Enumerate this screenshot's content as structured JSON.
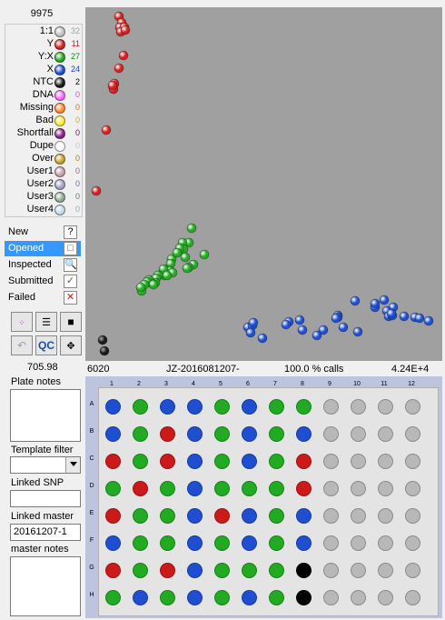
{
  "top_count": "9975",
  "legend": [
    {
      "label": "1:1",
      "count": "32",
      "color": "#c0c0c0",
      "count_color": "#a0a0a0"
    },
    {
      "label": "Y",
      "count": "11",
      "color": "#d42020",
      "count_color": "#c01818"
    },
    {
      "label": "Y:X",
      "count": "27",
      "color": "#22aa22",
      "count_color": "#118811"
    },
    {
      "label": "X",
      "count": "24",
      "color": "#1f4fd0",
      "count_color": "#1a3fcc"
    },
    {
      "label": "NTC",
      "count": "2",
      "color": "#1a1a1a",
      "count_color": "#000000"
    },
    {
      "label": "DNA",
      "count": "0",
      "color": "#ff66ff",
      "count_color": "#d050d0"
    },
    {
      "label": "Missing",
      "count": "0",
      "color": "#ff8833",
      "count_color": "#d07020"
    },
    {
      "label": "Bad",
      "count": "0",
      "color": "#ffee33",
      "count_color": "#c8b020"
    },
    {
      "label": "Shortfall",
      "count": "0",
      "color": "#882288",
      "count_color": "#661166"
    },
    {
      "label": "Dupe",
      "count": "0",
      "color": "#ffffff",
      "count_color": "#c8c8c8"
    },
    {
      "label": "Over",
      "count": "0",
      "color": "#c8a030",
      "count_color": "#a88020"
    },
    {
      "label": "User1",
      "count": "0",
      "color": "#c8a0a8",
      "count_color": "#907078"
    },
    {
      "label": "User2",
      "count": "0",
      "color": "#a0a0c8",
      "count_color": "#7070a0"
    },
    {
      "label": "User3",
      "count": "0",
      "color": "#90a890",
      "count_color": "#608060"
    },
    {
      "label": "User4",
      "count": "0",
      "color": "#c0d8e8",
      "count_color": "#90a8b8"
    }
  ],
  "status": [
    {
      "label": "New",
      "icon": "?"
    },
    {
      "label": "Opened",
      "icon": "□"
    },
    {
      "label": "Inspected",
      "icon": "🔍"
    },
    {
      "label": "Submitted",
      "icon": "✓"
    },
    {
      "label": "Failed",
      "icon": "✕"
    }
  ],
  "toolbar": {
    "qc": "QC"
  },
  "numeric_value": "705.98",
  "plate_notes_label": "Plate notes",
  "template_filter_label": "Template filter",
  "linked_snp_label": "Linked SNP",
  "linked_master_label": "Linked master",
  "linked_master_value": "20161207-1",
  "master_notes_label": "master notes",
  "infobar": {
    "left": "6020",
    "name": "JZ-2016081207-",
    "calls": "100.0 % calls",
    "right": "4.24E+4"
  },
  "plate": {
    "columns": [
      "1",
      "2",
      "3",
      "4",
      "5",
      "6",
      "7",
      "8",
      "9",
      "10",
      "11",
      "12"
    ],
    "rows": [
      "A",
      "B",
      "C",
      "D",
      "E",
      "F",
      "G",
      "H"
    ],
    "wells": [
      [
        "X",
        "YX",
        "X",
        "X",
        "YX",
        "X",
        "YX",
        "YX",
        "E",
        "E",
        "E",
        "E"
      ],
      [
        "X",
        "YX",
        "Y",
        "X",
        "YX",
        "X",
        "YX",
        "X",
        "E",
        "E",
        "E",
        "E"
      ],
      [
        "Y",
        "YX",
        "Y",
        "X",
        "YX",
        "X",
        "YX",
        "Y",
        "E",
        "E",
        "E",
        "E"
      ],
      [
        "YX",
        "Y",
        "YX",
        "X",
        "YX",
        "YX",
        "YX",
        "Y",
        "E",
        "E",
        "E",
        "E"
      ],
      [
        "Y",
        "YX",
        "YX",
        "X",
        "Y",
        "X",
        "YX",
        "X",
        "E",
        "E",
        "E",
        "E"
      ],
      [
        "X",
        "YX",
        "YX",
        "X",
        "YX",
        "X",
        "YX",
        "X",
        "E",
        "E",
        "E",
        "E"
      ],
      [
        "Y",
        "YX",
        "Y",
        "X",
        "YX",
        "YX",
        "YX",
        "N",
        "E",
        "E",
        "E",
        "E"
      ],
      [
        "YX",
        "X",
        "YX",
        "X",
        "YX",
        "X",
        "YX",
        "N",
        "E",
        "E",
        "E",
        "E"
      ]
    ],
    "well_colors": {
      "X": "#1f4fd0",
      "Y": "#cc1a1a",
      "YX": "#22aa22",
      "N": "#000000",
      "E": "#b8b8b8"
    }
  },
  "scatter": {
    "red": [
      [
        37,
        10
      ],
      [
        40,
        17
      ],
      [
        38,
        22
      ],
      [
        43,
        22
      ],
      [
        39,
        27
      ],
      [
        44,
        25
      ],
      [
        42,
        53
      ],
      [
        37,
        67
      ],
      [
        32,
        84
      ],
      [
        31,
        90
      ],
      [
        30,
        86
      ],
      [
        23,
        135
      ],
      [
        12,
        202
      ]
    ],
    "green": [
      [
        117,
        243
      ],
      [
        114,
        259
      ],
      [
        107,
        259
      ],
      [
        108,
        266
      ],
      [
        104,
        265
      ],
      [
        110,
        275
      ],
      [
        95,
        277
      ],
      [
        119,
        283
      ],
      [
        114,
        286
      ],
      [
        94,
        282
      ],
      [
        93,
        290
      ],
      [
        91,
        293
      ],
      [
        87,
        295
      ],
      [
        86,
        288
      ],
      [
        80,
        295
      ],
      [
        78,
        298
      ],
      [
        77,
        303
      ],
      [
        74,
        304
      ],
      [
        70,
        300
      ],
      [
        68,
        302
      ],
      [
        65,
        305
      ],
      [
        62,
        312
      ],
      [
        61,
        308
      ],
      [
        112,
        287
      ],
      [
        131,
        272
      ],
      [
        101,
        270
      ],
      [
        96,
        292
      ],
      [
        90,
        295
      ],
      [
        75,
        305
      ]
    ],
    "blue": [
      [
        297,
        323
      ],
      [
        329,
        322
      ],
      [
        339,
        330
      ],
      [
        332,
        334
      ],
      [
        319,
        330
      ],
      [
        334,
        340
      ],
      [
        338,
        339
      ],
      [
        351,
        340
      ],
      [
        363,
        341
      ],
      [
        378,
        345
      ],
      [
        368,
        342
      ],
      [
        337,
        337
      ],
      [
        319,
        326
      ],
      [
        278,
        339
      ],
      [
        278,
        341
      ],
      [
        276,
        342
      ],
      [
        262,
        355
      ],
      [
        284,
        352
      ],
      [
        300,
        357
      ],
      [
        255,
        361
      ],
      [
        224,
        346
      ],
      [
        236,
        344
      ],
      [
        221,
        349
      ],
      [
        239,
        355
      ],
      [
        179,
        352
      ],
      [
        184,
        350
      ],
      [
        185,
        347
      ],
      [
        182,
        358
      ],
      [
        195,
        364
      ]
    ],
    "black": [
      [
        19,
        366
      ],
      [
        21,
        378
      ]
    ]
  }
}
